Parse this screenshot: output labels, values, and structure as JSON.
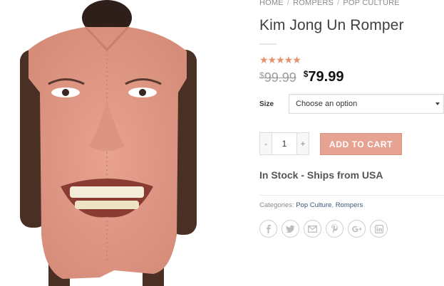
{
  "breadcrumb": {
    "items": [
      "HOME",
      "ROMPERS",
      "POP CULTURE"
    ],
    "separator": "/"
  },
  "product": {
    "title": "Kim Jong Un Romper",
    "rating_stars": "★★★★★",
    "rating_fraction": 1.0,
    "old_price_symbol": "$",
    "old_price": "99.99",
    "new_price_symbol": "$",
    "new_price": "79.99"
  },
  "options": {
    "size_label": "Size",
    "size_selected": "Choose an option"
  },
  "cart": {
    "minus": "-",
    "quantity": "1",
    "plus": "+",
    "add_label": "ADD TO CART"
  },
  "stock_text": "In Stock - Ships from USA",
  "categories": {
    "label": "Categories:",
    "items": [
      "Pop Culture",
      "Rompers"
    ],
    "separator": ","
  },
  "share_icons": [
    "facebook-icon",
    "twitter-icon",
    "email-icon",
    "pinterest-icon",
    "google-plus-icon",
    "linkedin-icon"
  ],
  "colors": {
    "accent": "#e6a391",
    "stars": "#e6916e",
    "link": "#3c5a7a"
  }
}
